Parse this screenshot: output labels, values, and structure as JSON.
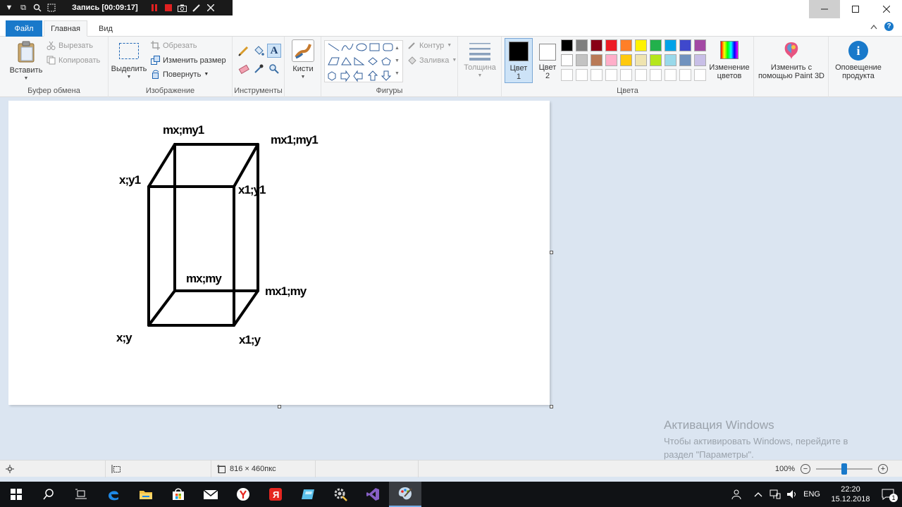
{
  "recorder": {
    "title": "Запись [00:09:17]"
  },
  "tabs": {
    "file": "Файл",
    "home": "Главная",
    "view": "Вид"
  },
  "clipboard": {
    "paste": "Вставить",
    "cut": "Вырезать",
    "copy": "Копировать",
    "label": "Буфер обмена"
  },
  "image": {
    "select": "Выделить",
    "crop": "Обрезать",
    "resize": "Изменить размер",
    "rotate": "Повернуть",
    "label": "Изображение"
  },
  "tools": {
    "label": "Инструменты"
  },
  "brushes": {
    "label": "Кисти"
  },
  "shapes": {
    "outline": "Контур",
    "fill": "Заливка",
    "label": "Фигуры"
  },
  "thickness": {
    "label": "Толщина"
  },
  "colors": {
    "color1_line1": "Цвет",
    "color1_line2": "1",
    "color2_line1": "Цвет",
    "color2_line2": "2",
    "label": "Цвета",
    "edit_line1": "Изменение",
    "edit_line2": "цветов",
    "color1_value": "#000000",
    "color2_value": "#ffffff",
    "palette_row1": [
      "#000000",
      "#7f7f7f",
      "#880015",
      "#ed1c24",
      "#ff7f27",
      "#fff200",
      "#22b14c",
      "#00a2e8",
      "#3f48cc",
      "#a349a4"
    ],
    "palette_row2": [
      "#ffffff",
      "#c3c3c3",
      "#b97a57",
      "#ffaec9",
      "#ffc90e",
      "#efe4b0",
      "#b5e61d",
      "#99d9ea",
      "#7092be",
      "#c8bfe7"
    ]
  },
  "paint3d": {
    "line1": "Изменить с",
    "line2": "помощью Paint 3D"
  },
  "notify": {
    "line1": "Оповещение",
    "line2": "продукта"
  },
  "drawing": {
    "labels": {
      "mx_my1": "mx;my1",
      "mx1_my1": "mx1;my1",
      "x_y1": "x;y1",
      "x1_y1": "x1;y1",
      "mx_my": "mx;my",
      "mx1_my": "mx1;my",
      "x_y": "x;y",
      "x1_y": "x1;y"
    }
  },
  "watermark": {
    "title": "Активация Windows",
    "line1": "Чтобы активировать Windows, перейдите в",
    "line2": "раздел \"Параметры\"."
  },
  "status": {
    "canvas_size": "816 × 460пкс",
    "zoom": "100%"
  },
  "taskbar": {
    "lang": "ENG",
    "time": "22:20",
    "date": "15.12.2018",
    "notif_count": "1"
  }
}
